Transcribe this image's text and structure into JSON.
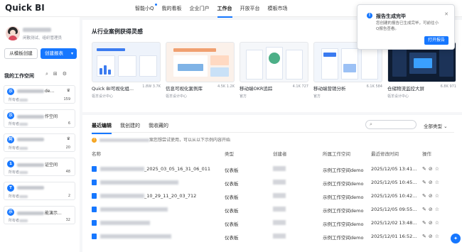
{
  "app": {
    "logo": "Quick BI"
  },
  "nav": [
    {
      "label": "智能小Q"
    },
    {
      "label": "我的看板"
    },
    {
      "label": "企业门户"
    },
    {
      "label": "工作台"
    },
    {
      "label": "开放平台"
    },
    {
      "label": "模板市场"
    }
  ],
  "profile": {
    "role": "闲散测试、组织管理员"
  },
  "sidebar": {
    "template_button": "从模板创建",
    "create_button": "创建报表",
    "workspace_title": "我的工作空间",
    "workspaces": [
      {
        "badge": "示",
        "name_suffix": "de...",
        "owner_prefix": "所有者",
        "count": "159"
      },
      {
        "badge": "示",
        "name_suffix": "作空间",
        "owner_prefix": "所有者",
        "count": "6"
      },
      {
        "badge": "阿",
        "name_suffix": "",
        "owner_prefix": "所有者",
        "count": "20"
      },
      {
        "badge": "1",
        "name_suffix": "证空间",
        "owner_prefix": "所有者",
        "count": "48"
      },
      {
        "badge": "T",
        "name_suffix": "",
        "owner_prefix": "所有者",
        "count": "2"
      },
      {
        "badge": "示",
        "name_suffix": "能演示...",
        "owner_prefix": "所有者",
        "count": "32"
      }
    ]
  },
  "inspire": {
    "title": "从行业案例获得灵感",
    "cases": [
      {
        "name": "Quick BI可视化组...",
        "stats": "1.8W 3.7K",
        "sub": "瓴羊设计中心"
      },
      {
        "name": "信息可视化案例库",
        "stats": "4.5K 1.2K",
        "sub": "瓴羊设计中心"
      },
      {
        "name": "移动端OKR追踪",
        "stats": "4.1K 727",
        "sub": "官方"
      },
      {
        "name": "移动端营销分析",
        "stats": "6.1K 584",
        "sub": "官方"
      },
      {
        "name": "仓储物流监控大屏",
        "stats": "6.8K 971",
        "sub": "瓴羊设计中心"
      }
    ]
  },
  "docs": {
    "tabs": [
      "最近编辑",
      "我创建的",
      "我收藏的"
    ],
    "search_icon": "search-icon",
    "filter": "全部类型",
    "notice": "案您想尝试使用，可以从以下示例内容开始",
    "columns": [
      "名称",
      "类型",
      "创建者",
      "所属工作空间",
      "最近修改时间",
      "操作"
    ],
    "rows": [
      {
        "name": "_2025_03_05_16_31_06_011",
        "type": "仪表板",
        "workspace": "示例工作空间demo",
        "time": "2025/12/05 13:41..."
      },
      {
        "name": "",
        "type": "仪表板",
        "workspace": "示例工作空间demo",
        "time": "2025/12/05 10:45..."
      },
      {
        "name": "_10_29_11_20_03_712",
        "type": "仪表板",
        "workspace": "示例工作空间demo",
        "time": "2025/12/05 10:42..."
      },
      {
        "name": "",
        "type": "仪表板",
        "workspace": "示例工作空间demo",
        "time": "2025/12/05 09:55..."
      },
      {
        "name": "",
        "type": "仪表板",
        "workspace": "示例工作空间demo",
        "time": "2025/12/02 13:48..."
      },
      {
        "name": "",
        "type": "仪表板",
        "workspace": "示例工作空间demo",
        "time": "2025/12/01 16:52..."
      }
    ]
  },
  "toast": {
    "title": "报告生成完毕",
    "body": "您创建的报告已生成完毕，可前往小Q报告查看。",
    "button": "打开报告"
  },
  "colors": {
    "accent": "#1677ff",
    "warning": "#f5a623"
  }
}
